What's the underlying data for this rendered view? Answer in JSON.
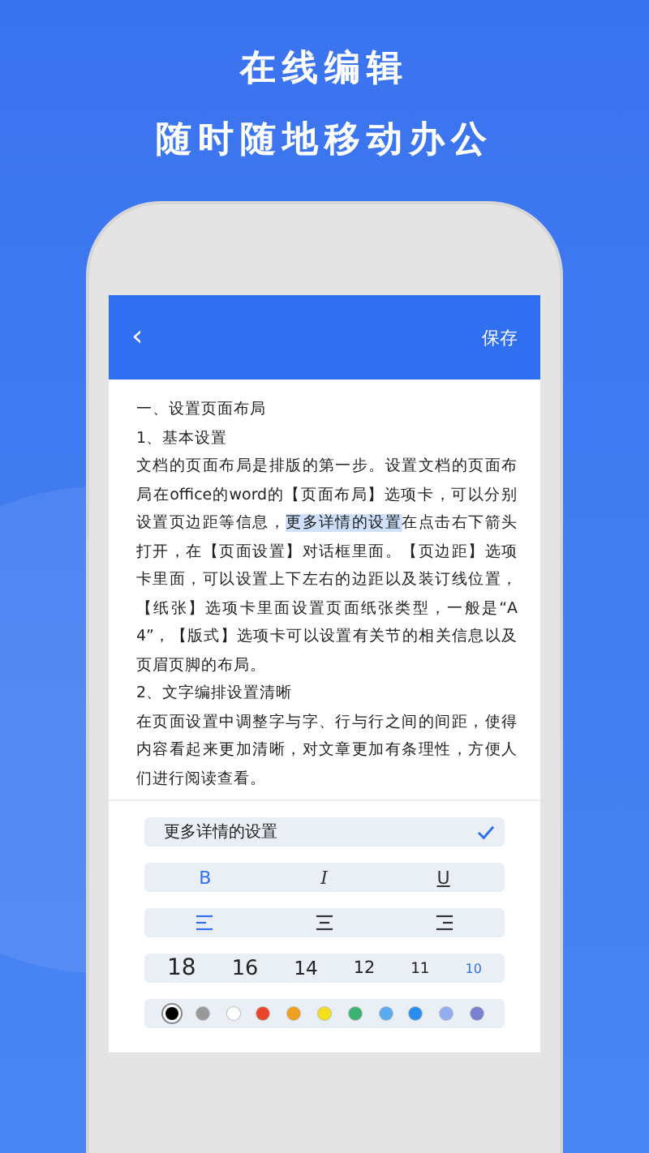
{
  "headline": [
    "在线编辑",
    "随时随地移动办公"
  ],
  "app_bar": {
    "back": "‹",
    "action": "保存"
  },
  "document": {
    "heading": "一、设置页面布局",
    "subheading": "1、基本设置",
    "paragraph_1": {
      "before": "文档的页面布局是排版的第一步。设置文档的页面布局在office的word的【页面布局】选项卡，可以分别设置页边距等信息，",
      "selection": "更多详情的设置",
      "after": "在点击右下箭头打开，在【页面设置】对话框里面。【页边距】选项卡里面，可以设置上下左右的边距以及装订线位置，【纸张】选项卡里面设置页面纸张类型，一般是“A4”，【版式】选项卡可以设置有关节的相关信息以及页眉页脚的布局。"
    },
    "subheading_2": "2、文字编排设置清晰",
    "paragraph_2": "在页面设置中调整字与字、行与行之间的间距，使得内容看起来更加清晰，对文章更加有条理性，方便人们进行阅读查看。"
  },
  "toolbar": {
    "option": {
      "label": "更多详情的设置",
      "checked": true
    },
    "styles": [
      {
        "kind": "bold",
        "label": "B",
        "selected": true
      },
      {
        "kind": "italic",
        "label": "I",
        "selected": false
      },
      {
        "kind": "underline",
        "label": "U",
        "selected": false
      }
    ],
    "alignments": [
      {
        "kind": "left",
        "selected": true
      },
      {
        "kind": "center",
        "selected": false
      },
      {
        "kind": "right",
        "selected": false
      }
    ],
    "sizes": [
      {
        "label": "18",
        "selected": false
      },
      {
        "label": "16",
        "selected": false
      },
      {
        "label": "14",
        "selected": false
      },
      {
        "label": "12",
        "selected": false
      },
      {
        "label": "11",
        "selected": false
      },
      {
        "label": "10",
        "selected": true
      }
    ],
    "colors": [
      {
        "color": "#000000",
        "selected": true
      },
      {
        "color": "#999999",
        "selected": false
      },
      {
        "color": "#ffffff",
        "selected": false
      },
      {
        "color": "#e8452c",
        "selected": false
      },
      {
        "color": "#f0a020",
        "selected": false
      },
      {
        "color": "#f5e020",
        "selected": false
      },
      {
        "color": "#3cb371",
        "selected": false
      },
      {
        "color": "#5aaaf0",
        "selected": false
      },
      {
        "color": "#2a8ef0",
        "selected": false
      },
      {
        "color": "#90aef0",
        "selected": false
      },
      {
        "color": "#7a80d0",
        "selected": false
      }
    ]
  }
}
